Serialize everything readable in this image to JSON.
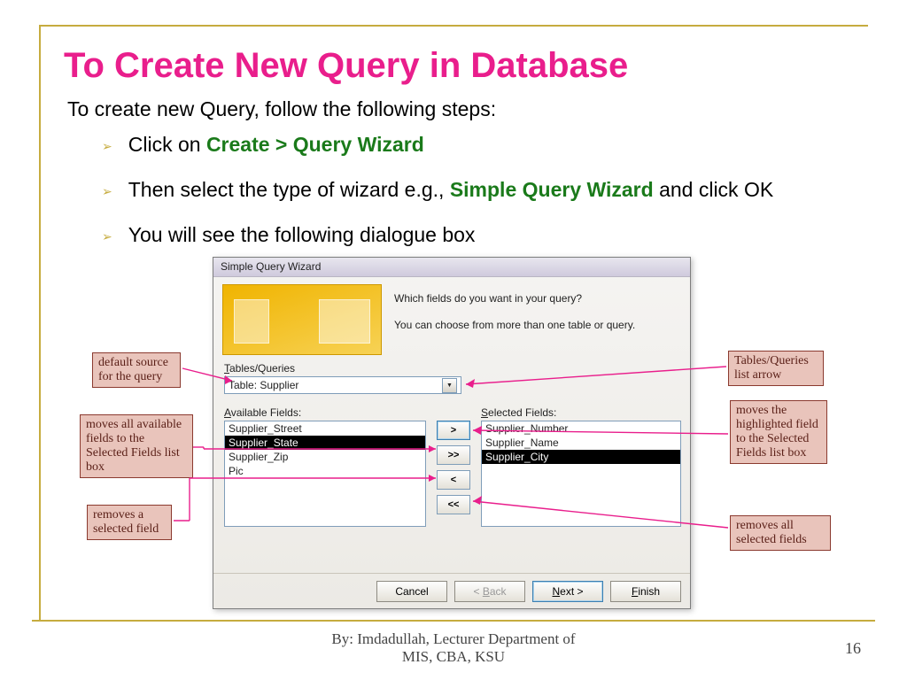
{
  "title": "To Create New Query in Database",
  "intro": "To create new Query, follow the following steps:",
  "bullets": {
    "b1_pre": "Click on ",
    "b1_bold": "Create > Query Wizard",
    "b2_pre": "Then select the type of wizard e.g., ",
    "b2_bold": "Simple Query Wizard",
    "b2_post": " and click OK",
    "b3": "You will see the following dialogue box"
  },
  "dialog": {
    "title": "Simple Query Wizard",
    "q1": "Which fields do you want in your query?",
    "q2": "You can choose from more than one table or query.",
    "tables_label_u": "T",
    "tables_label_rest": "ables/Queries",
    "combo_value": "Table: Supplier",
    "avail_label_u": "A",
    "avail_label_rest": "vailable Fields:",
    "sel_label_u": "S",
    "sel_label_rest": "elected Fields:",
    "available": [
      "Supplier_Street",
      "Supplier_State",
      "Supplier_Zip",
      "Pic"
    ],
    "available_selected_index": 1,
    "selected": [
      "Supplier_Number",
      "Supplier_Name",
      "Supplier_City"
    ],
    "selected_selected_index": 2,
    "btn_add": ">",
    "btn_addall": ">>",
    "btn_remove": "<",
    "btn_removeall": "<<",
    "btn_cancel": "Cancel",
    "btn_back_pre": "< ",
    "btn_back_u": "B",
    "btn_back_post": "ack",
    "btn_next_u": "N",
    "btn_next_post": "ext >",
    "btn_finish_u": "F",
    "btn_finish_post": "inish"
  },
  "callouts": {
    "c_default": "default source for the query",
    "c_moveall": "moves all available fields to the Selected Fields list box",
    "c_remove1": "removes a selected field",
    "c_listarrow": "Tables/Queries list arrow",
    "c_moveone": "moves the highlighted field to the Selected Fields list box",
    "c_removeall": "removes all selected fields"
  },
  "footer1": "By: Imdadullah, Lecturer Department of",
  "footer2": "MIS, CBA, KSU",
  "page": "16"
}
